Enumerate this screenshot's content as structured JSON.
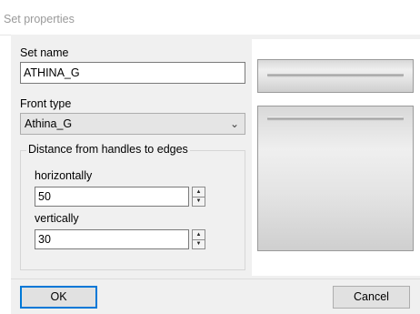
{
  "window": {
    "title": "Set properties"
  },
  "set_name": {
    "label": "Set name",
    "value": "ATHINA_G"
  },
  "front_type": {
    "label": "Front type",
    "selected": "Athina_G"
  },
  "distance_group": {
    "title": "Distance from handles to edges",
    "horizontal": {
      "label": "horizontally",
      "value": "50"
    },
    "vertical": {
      "label": "vertically",
      "value": "30"
    }
  },
  "buttons": {
    "ok": "OK",
    "cancel": "Cancel"
  },
  "icons": {
    "combo_arrow": "chevron-down-icon",
    "spin_up": "triangle-up-icon",
    "spin_down": "triangle-down-icon"
  }
}
